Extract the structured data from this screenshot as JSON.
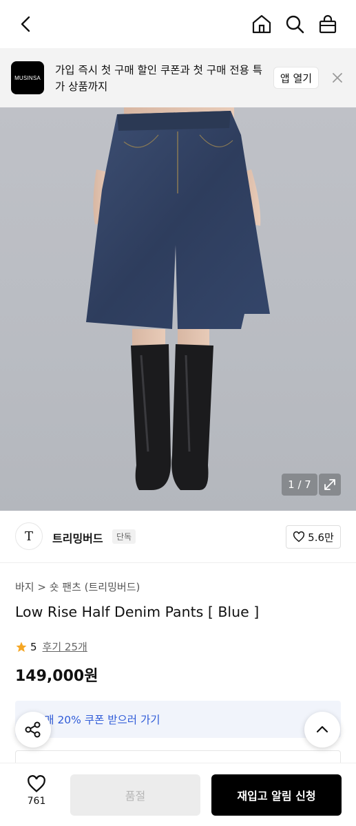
{
  "header": {
    "back_icon": "chevron-left-icon",
    "home_icon": "home-icon",
    "search_icon": "search-icon",
    "cart_icon": "shopping-bag-icon"
  },
  "banner": {
    "logo_text": "MUSINSA",
    "message": "가입 즉시 첫 구매 할인 쿠폰과 첫 구매 전용 특가 상품까지",
    "open_app_label": "앱 열기",
    "close_icon": "close-icon"
  },
  "gallery": {
    "counter": "1 / 7",
    "expand_icon": "expand-icon"
  },
  "brand": {
    "logo_text": "T",
    "name": "트리밍버드",
    "badge": "단독",
    "likes": "5.6만"
  },
  "product": {
    "breadcrumb": "바지 > 숏 팬츠 (트리밍버드)",
    "title": "Low Rise Half Denim Pants [ Blue ]",
    "rating": "5",
    "reviews": "후기 25개",
    "price": "149,000원"
  },
  "coupon": {
    "text": "구매 20% 쿠폰 받으러 가기"
  },
  "bottom_bar": {
    "like_count": "761",
    "soldout_label": "품절",
    "restock_label": "재입고 알림 신청"
  },
  "colors": {
    "accent_blue": "#2f5bd8",
    "star": "#f5a623",
    "cta": "#000000"
  }
}
